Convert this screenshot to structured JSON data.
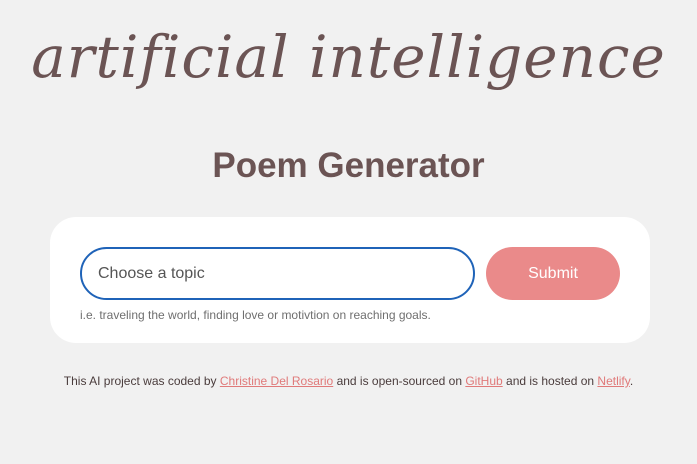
{
  "header": {
    "script_title": "artificial intelligence",
    "title": "Poem Generator"
  },
  "form": {
    "input_placeholder": "Choose a topic",
    "input_value": "",
    "submit_label": "Submit",
    "hint": "i.e. traveling the world, finding love or motivtion on reaching goals."
  },
  "footer": {
    "text_1": "This AI project was coded by ",
    "author_link": "Christine Del Rosario",
    "text_2": " and is open-sourced on ",
    "github_link": "GitHub",
    "text_3": " and is hosted on ",
    "netlify_link": "Netlify",
    "text_4": "."
  },
  "colors": {
    "background": "#f1f1f1",
    "text": "#6b5454",
    "accent": "#ea8a8a",
    "input_border": "#1f63b8",
    "link": "#e07a7a"
  }
}
